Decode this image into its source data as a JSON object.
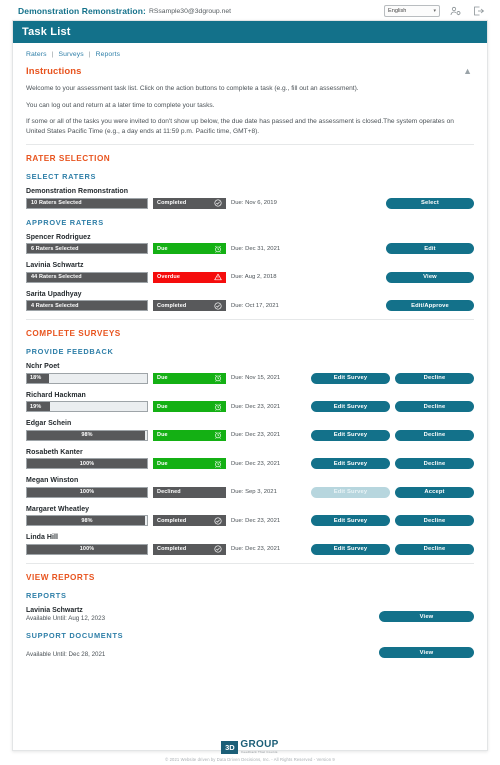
{
  "topbar": {
    "title": "Demonstration Remonstration:",
    "email": "RSsample30@3dgroup.net",
    "language": "English",
    "language_options": [
      "English"
    ],
    "user_icon": "user-gear-icon",
    "logout_icon": "logout-icon"
  },
  "header": {
    "title": "Task List"
  },
  "breadcrumb": {
    "raters": "Raters",
    "surveys": "Surveys",
    "reports": "Reports",
    "separator": "|"
  },
  "instructions": {
    "heading": "Instructions",
    "collapse_icon": "chevron-up-icon",
    "paragraphs": [
      "Welcome to your assessment task list. Click on the action buttons to complete a task (e.g., fill out an assessment).",
      "You can log out and return at a later time to complete your tasks.",
      "If some or all of the tasks you were invited to don't show up below, the due date has passed and the assessment is closed.The system operates on United States Pacific Time (e.g., a day ends at 11:59 p.m. Pacific time, GMT+8)."
    ]
  },
  "rater_selection": {
    "heading": "RATER SELECTION",
    "select_raters": {
      "heading": "SELECT RATERS",
      "rows": [
        {
          "name": "Demonstration Remonstration",
          "bar_label": "10 Raters Selected",
          "bar_fill": 100,
          "status": "Completed",
          "status_kind": "completed",
          "status_icon": "check-circle-icon",
          "due": "Due: Nov 6, 2019",
          "actions": [
            {
              "label": "Select",
              "width": "w-select",
              "disabled": false
            }
          ]
        }
      ]
    },
    "approve_raters": {
      "heading": "APPROVE RATERS",
      "rows": [
        {
          "name": "Spencer Rodriguez",
          "bar_label": "6 Raters Selected",
          "bar_fill": 100,
          "status": "Due",
          "status_kind": "due",
          "status_icon": "alarm-clock-icon",
          "due": "Due: Dec 31, 2021",
          "actions": [
            {
              "label": "Edit",
              "width": "w-select",
              "disabled": false
            }
          ]
        },
        {
          "name": "Lavinia Schwartz",
          "bar_label": "44 Raters Selected",
          "bar_fill": 100,
          "status": "Overdue",
          "status_kind": "overdue",
          "status_icon": "warning-triangle-icon",
          "due": "Due: Aug 2, 2018",
          "actions": [
            {
              "label": "View",
              "width": "w-select",
              "disabled": false
            }
          ]
        },
        {
          "name": "Sarita Upadhyay",
          "bar_label": "4 Raters Selected",
          "bar_fill": 100,
          "status": "Completed",
          "status_kind": "completed",
          "status_icon": "check-circle-icon",
          "due": "Due: Oct 17, 2021",
          "actions": [
            {
              "label": "Edit/Approve",
              "width": "w-select",
              "disabled": false
            }
          ]
        }
      ]
    }
  },
  "complete_surveys": {
    "heading": "Complete Surveys",
    "provide_feedback": {
      "heading": "PROVIDE FEEDBACK",
      "rows": [
        {
          "name": "Nchr Poet",
          "bar_label": "18%",
          "bar_fill": 18,
          "status": "Due",
          "status_kind": "due",
          "status_icon": "alarm-clock-icon",
          "due": "Due: Nov 15, 2021",
          "actions": [
            {
              "label": "Edit Survey",
              "width": "w-dual",
              "disabled": false
            },
            {
              "label": "Decline",
              "width": "w-dual",
              "disabled": false
            }
          ]
        },
        {
          "name": "Richard Hackman",
          "bar_label": "19%",
          "bar_fill": 19,
          "status": "Due",
          "status_kind": "due",
          "status_icon": "alarm-clock-icon",
          "due": "Due: Dec 23, 2021",
          "actions": [
            {
              "label": "Edit Survey",
              "width": "w-dual",
              "disabled": false
            },
            {
              "label": "Decline",
              "width": "w-dual",
              "disabled": false
            }
          ]
        },
        {
          "name": "Edgar Schein",
          "bar_label": "98%",
          "bar_fill": 98,
          "status": "Due",
          "status_kind": "due",
          "status_icon": "alarm-clock-icon",
          "due": "Due: Dec 23, 2021",
          "actions": [
            {
              "label": "Edit Survey",
              "width": "w-dual",
              "disabled": false
            },
            {
              "label": "Decline",
              "width": "w-dual",
              "disabled": false
            }
          ]
        },
        {
          "name": "Rosabeth Kanter",
          "bar_label": "100%",
          "bar_fill": 100,
          "status": "Due",
          "status_kind": "due",
          "status_icon": "alarm-clock-icon",
          "due": "Due: Dec 23, 2021",
          "actions": [
            {
              "label": "Edit Survey",
              "width": "w-dual",
              "disabled": false
            },
            {
              "label": "Decline",
              "width": "w-dual",
              "disabled": false
            }
          ]
        },
        {
          "name": "Megan Winston",
          "bar_label": "100%",
          "bar_fill": 100,
          "status": "Declined",
          "status_kind": "declined",
          "status_icon": "none",
          "due": "Due: Sep 3, 2021",
          "actions": [
            {
              "label": "Edit Survey",
              "width": "w-dual",
              "disabled": true
            },
            {
              "label": "Accept",
              "width": "w-dual",
              "disabled": false
            }
          ]
        },
        {
          "name": "Margaret Wheatley",
          "bar_label": "98%",
          "bar_fill": 98,
          "status": "Completed",
          "status_kind": "completed",
          "status_icon": "check-circle-icon",
          "due": "Due: Dec 23, 2021",
          "actions": [
            {
              "label": "Edit Survey",
              "width": "w-dual",
              "disabled": false
            },
            {
              "label": "Decline",
              "width": "w-dual",
              "disabled": false
            }
          ]
        },
        {
          "name": "Linda Hill",
          "bar_label": "100%",
          "bar_fill": 100,
          "status": "Completed",
          "status_kind": "completed",
          "status_icon": "check-circle-icon",
          "due": "Due: Dec 23, 2021",
          "actions": [
            {
              "label": "Edit Survey",
              "width": "w-dual",
              "disabled": false
            },
            {
              "label": "Decline",
              "width": "w-dual",
              "disabled": false
            }
          ]
        }
      ]
    }
  },
  "view_reports": {
    "heading": "View Reports",
    "reports": {
      "heading": "REPORTS",
      "rows": [
        {
          "name": "Lavinia Schwartz",
          "available": "Available Until: Aug 12, 2023",
          "button": "View"
        }
      ]
    },
    "support_documents": {
      "heading": "SUPPORT DOCUMENTS",
      "rows": [
        {
          "name": "",
          "available": "Available Until: Dec 28, 2021",
          "button": "View"
        }
      ]
    }
  },
  "footer": {
    "logo_mark": "3D",
    "logo_word": "GROUP",
    "logo_tagline": "Feedback That Counts",
    "copyright": "© 2021 Website driven by Data Driven Decisions, Inc. - All Rights Reserved - Version 9"
  },
  "colors": {
    "teal": "#13718a",
    "orange": "#e8541f",
    "blue": "#2f7fa8",
    "green": "#14b014",
    "red": "#f50c0c",
    "gray": "#58595b"
  }
}
